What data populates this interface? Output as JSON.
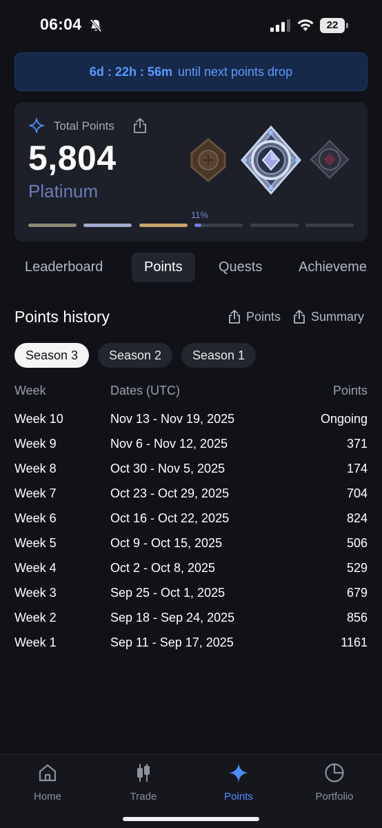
{
  "status_bar": {
    "time": "06:04",
    "battery": "22"
  },
  "banner": {
    "countdown": "6d : 22h : 56m",
    "text": "until next points drop"
  },
  "points_card": {
    "label": "Total Points",
    "value": "5,804",
    "tier": "Platinum",
    "progress_label": "11%",
    "progress_fraction": 0.11,
    "segment_colors": [
      "#8f8675",
      "#a1a8c8",
      "#c7a56b",
      "#3a3e4b",
      "#3a3e4b",
      "#3a3e4b"
    ]
  },
  "tabs": [
    {
      "label": "Leaderboard"
    },
    {
      "label": "Points"
    },
    {
      "label": "Quests"
    },
    {
      "label": "Achieveme"
    }
  ],
  "history": {
    "title": "Points history",
    "export_points": "Points",
    "export_summary": "Summary",
    "seasons": [
      {
        "label": "Season 3"
      },
      {
        "label": "Season 2"
      },
      {
        "label": "Season 1"
      }
    ],
    "columns": {
      "week": "Week",
      "dates": "Dates (UTC)",
      "points": "Points"
    },
    "rows": [
      {
        "week": "Week 10",
        "dates": "Nov 13 - Nov 19, 2025",
        "points": "Ongoing"
      },
      {
        "week": "Week 9",
        "dates": "Nov 6 - Nov 12, 2025",
        "points": "371"
      },
      {
        "week": "Week 8",
        "dates": "Oct 30 - Nov 5, 2025",
        "points": "174"
      },
      {
        "week": "Week 7",
        "dates": "Oct 23 - Oct 29, 2025",
        "points": "704"
      },
      {
        "week": "Week 6",
        "dates": "Oct 16 - Oct 22, 2025",
        "points": "824"
      },
      {
        "week": "Week 5",
        "dates": "Oct 9 - Oct 15, 2025",
        "points": "506"
      },
      {
        "week": "Week 4",
        "dates": "Oct 2 - Oct 8, 2025",
        "points": "529"
      },
      {
        "week": "Week 3",
        "dates": "Sep 25 - Oct 1, 2025",
        "points": "679"
      },
      {
        "week": "Week 2",
        "dates": "Sep 18 - Sep 24, 2025",
        "points": "856"
      },
      {
        "week": "Week 1",
        "dates": "Sep 11 - Sep 17, 2025",
        "points": "1161"
      }
    ]
  },
  "nav": [
    {
      "label": "Home",
      "icon": "home-icon"
    },
    {
      "label": "Trade",
      "icon": "trade-icon"
    },
    {
      "label": "Points",
      "icon": "sparkle-icon"
    },
    {
      "label": "Portfolio",
      "icon": "pie-chart-icon"
    }
  ],
  "colors": {
    "accent": "#4d8dff",
    "tier": "#6e7ab8",
    "background": "#101218"
  }
}
